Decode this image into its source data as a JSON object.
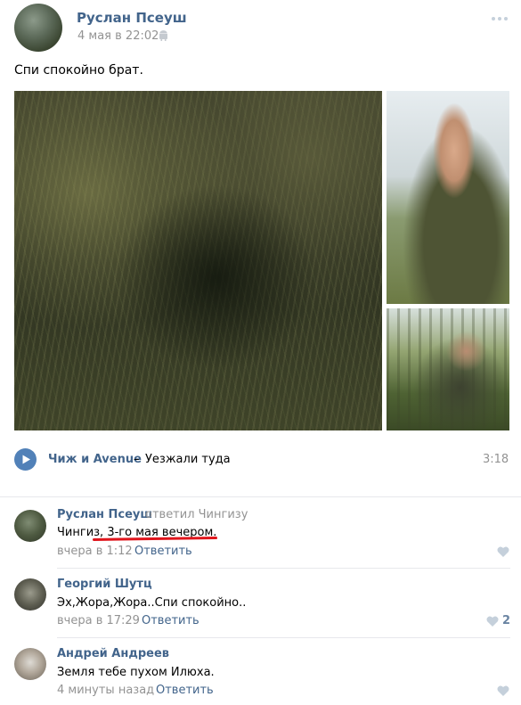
{
  "post": {
    "author": "Руслан Псеуш",
    "date": "4 мая в 22:02",
    "text": "Спи спокойно брат."
  },
  "audio": {
    "artist": "Чиж и Avenue",
    "separator": "–",
    "title": "Уезжали туда",
    "duration": "3:18"
  },
  "comments": [
    {
      "author": "Руслан Псеуш",
      "reply_note": "ответил Чингизу",
      "text_prefix": "Чингиз, ",
      "text_highlight": "3-го мая вечером.",
      "time": "вчера в 1:12",
      "reply_label": "Ответить",
      "likes": ""
    },
    {
      "author": "Георгий Шутц",
      "text": "Эх,Жора,Жора..Спи спокойно..",
      "time": "вчера в 17:29",
      "reply_label": "Ответить",
      "likes": "2"
    },
    {
      "author": "Андрей Андреев",
      "text": "Земля тебе пухом Илюха.",
      "time": "4 минуты назад",
      "reply_label": "Ответить",
      "likes": ""
    }
  ],
  "icons": {
    "android": "android-icon",
    "more": "more-dots-icon",
    "play": "play-icon",
    "like": "heart-icon"
  },
  "colors": {
    "link": "#42648b",
    "muted": "#939393",
    "play_button": "#5181b8",
    "like_gray": "#c5d0db",
    "like_active": "#6a84a2",
    "highlight_underline": "#e0151c"
  }
}
